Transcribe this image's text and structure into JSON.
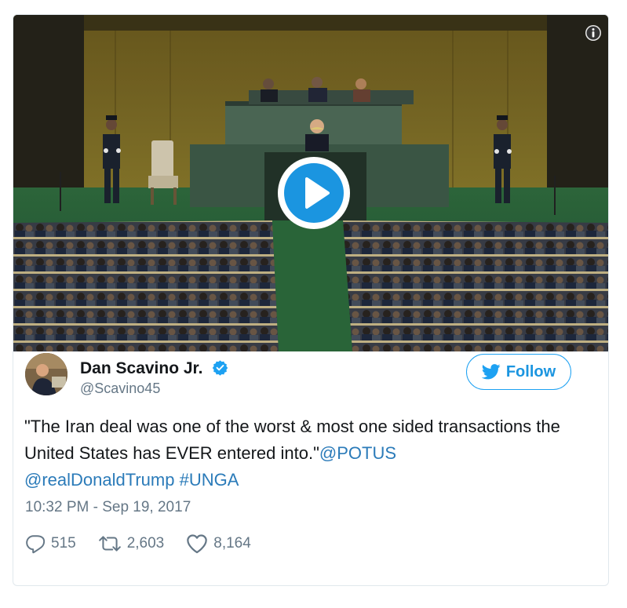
{
  "tweet": {
    "author": {
      "name": "Dan Scavino Jr.",
      "handle": "@Scavino45",
      "verified": true
    },
    "follow_label": "Follow",
    "text_main": "\"The Iran deal was one of the worst & most one sided transactions the United States has EVER entered into.\"",
    "mention_potus": "@POTUS",
    "mention_trump": "@realDonaldTrump",
    "hashtag": "#UNGA",
    "timestamp": "10:32 PM - Sep 19, 2017",
    "stats": {
      "replies": "515",
      "retweets": "2,603",
      "likes": "8,164"
    }
  },
  "icons": {
    "info": "info-icon",
    "play": "play-icon",
    "verified": "verified-badge-icon",
    "twitter_bird": "twitter-bird-icon",
    "reply": "reply-icon",
    "retweet": "retweet-icon",
    "like": "heart-icon"
  },
  "colors": {
    "accent": "#1da1f2",
    "link": "#2b7bb9",
    "muted": "#657786",
    "play_button": "#1b95e0"
  }
}
